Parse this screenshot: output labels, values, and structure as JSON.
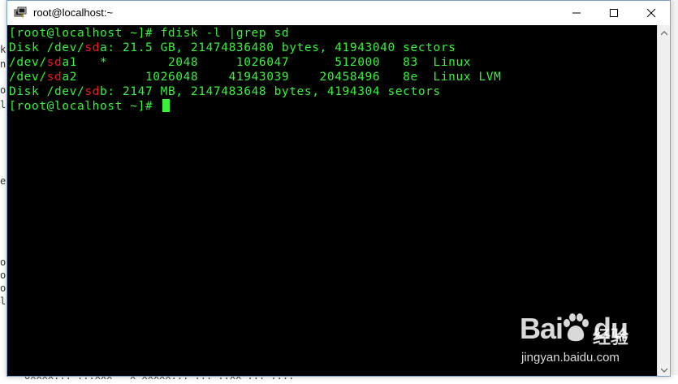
{
  "background": {
    "left_fragments": [
      "k",
      "n",
      "o",
      "l",
      "e",
      "o",
      "o",
      "o",
      "l"
    ],
    "bottom_fragment": "oxxxx...  ...xxx  --x xxxxx...  ...  ..xx  ...  ...."
  },
  "window": {
    "title": "root@localhost:~",
    "icon": "putty-terminal-icon",
    "buttons": {
      "minimize": "minimize-icon",
      "maximize": "maximize-icon",
      "close": "close-icon"
    }
  },
  "terminal": {
    "lines": [
      [
        {
          "t": "[root@localhost ~]# fdisk -l |grep sd"
        }
      ],
      [
        {
          "t": "Disk /dev/"
        },
        {
          "t": "sd",
          "hl": true
        },
        {
          "t": "a: 21.5 GB, 21474836480 bytes, 41943040 sectors"
        }
      ],
      [
        {
          "t": "/dev/"
        },
        {
          "t": "sd",
          "hl": true
        },
        {
          "t": "a1   *        2048     1026047      512000   83  Linux"
        }
      ],
      [
        {
          "t": "/dev/"
        },
        {
          "t": "sd",
          "hl": true
        },
        {
          "t": "a2         1026048    41943039    20458496   8e  Linux LVM"
        }
      ],
      [
        {
          "t": "Disk /dev/"
        },
        {
          "t": "sd",
          "hl": true
        },
        {
          "t": "b: 2147 MB, 2147483648 bytes, 4194304 sectors"
        }
      ],
      [
        {
          "t": "[root@localhost ~]# "
        },
        {
          "cursor": true
        }
      ]
    ],
    "colors": {
      "background": "#000000",
      "text": "#39f13a",
      "highlight": "#e81b1b"
    }
  },
  "watermark": {
    "brand": "Bai",
    "brand_suffix": "du",
    "cn_text": "经验",
    "url": "jingyan.baidu.com"
  }
}
